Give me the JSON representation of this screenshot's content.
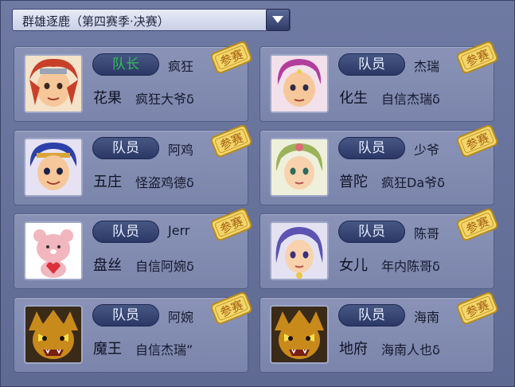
{
  "season_selector": {
    "label": "群雄逐鹿（第四赛季·决赛）"
  },
  "stamp_text": "参赛",
  "members": [
    {
      "role": "队长",
      "nickname": "疯狂",
      "server": "花果",
      "name": "疯狂大爷δ",
      "avatar": "red-haired-warrior",
      "color": "#c8402a"
    },
    {
      "role": "队员",
      "nickname": "杰瑞",
      "server": "化生",
      "name": "自信杰瑞δ",
      "avatar": "magenta-haired-hero",
      "color": "#b23e9c"
    },
    {
      "role": "队员",
      "nickname": "阿鸡",
      "server": "五庄",
      "name": "怪盗鸡德δ",
      "avatar": "blue-haired-monkey-king",
      "color": "#2d3fa8"
    },
    {
      "role": "队员",
      "nickname": "少爷",
      "server": "普陀",
      "name": "疯狂Da爷δ",
      "avatar": "green-haired-girl",
      "color": "#9cb25a"
    },
    {
      "role": "队员",
      "nickname": "Jerr",
      "server": "盘丝",
      "name": "自信阿婉δ",
      "avatar": "pink-bear",
      "color": "#f2b6bf"
    },
    {
      "role": "队员",
      "nickname": "陈哥",
      "server": "女儿",
      "name": "年内陈哥δ",
      "avatar": "purple-haired-girl",
      "color": "#5c53b3"
    },
    {
      "role": "队员",
      "nickname": "阿婉",
      "server": "魔王",
      "name": "自信杰瑞”",
      "avatar": "demon-king",
      "color": "#c98a1c"
    },
    {
      "role": "队员",
      "nickname": "海南",
      "server": "地府",
      "name": "海南人也δ",
      "avatar": "demon-king",
      "color": "#c98a1c"
    }
  ]
}
